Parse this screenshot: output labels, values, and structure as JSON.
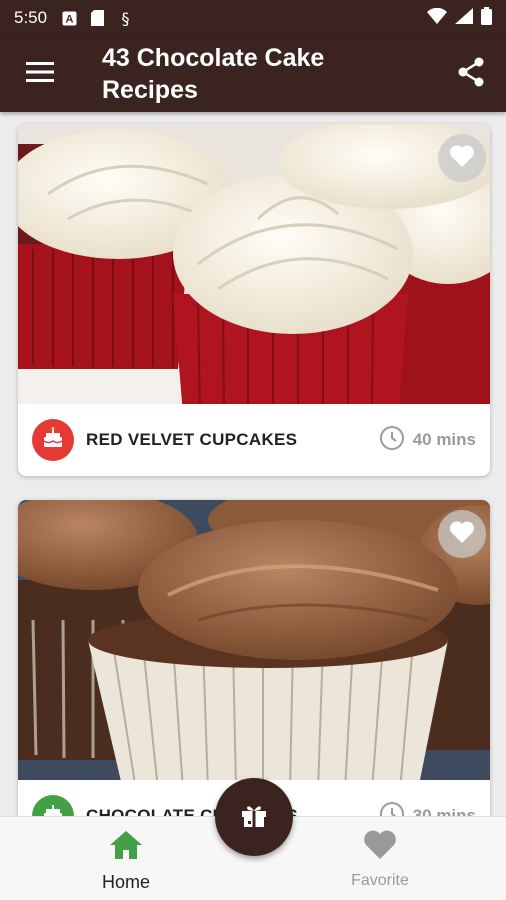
{
  "status_bar": {
    "time": "5:50",
    "icons": [
      "notification-a-icon",
      "sim-card-icon",
      "data-saver-icon",
      "wifi-icon",
      "signal-icon",
      "battery-icon"
    ]
  },
  "app_bar": {
    "title": "43 Chocolate Cake Recipes",
    "menu_icon": "menu-icon",
    "share_icon": "share-icon"
  },
  "recipes": [
    {
      "title": "RED VELVET CUPCAKES",
      "time": "40 mins",
      "badge_color": "#e53935",
      "badge_icon": "cake-icon",
      "favorite_icon": "heart-icon"
    },
    {
      "title": "CHOCOLATE CUPCAKES",
      "time": "30 mins",
      "badge_color": "#43a047",
      "badge_icon": "cake-icon",
      "favorite_icon": "heart-icon"
    }
  ],
  "bottom_nav": {
    "home_label": "Home",
    "favorite_label": "Favorite",
    "active_color": "#43a047",
    "inactive_color": "#9a9a9a"
  },
  "fab": {
    "icon": "gift-icon"
  },
  "colors": {
    "primary_dark": "#3b2420",
    "background": "#ececec"
  }
}
